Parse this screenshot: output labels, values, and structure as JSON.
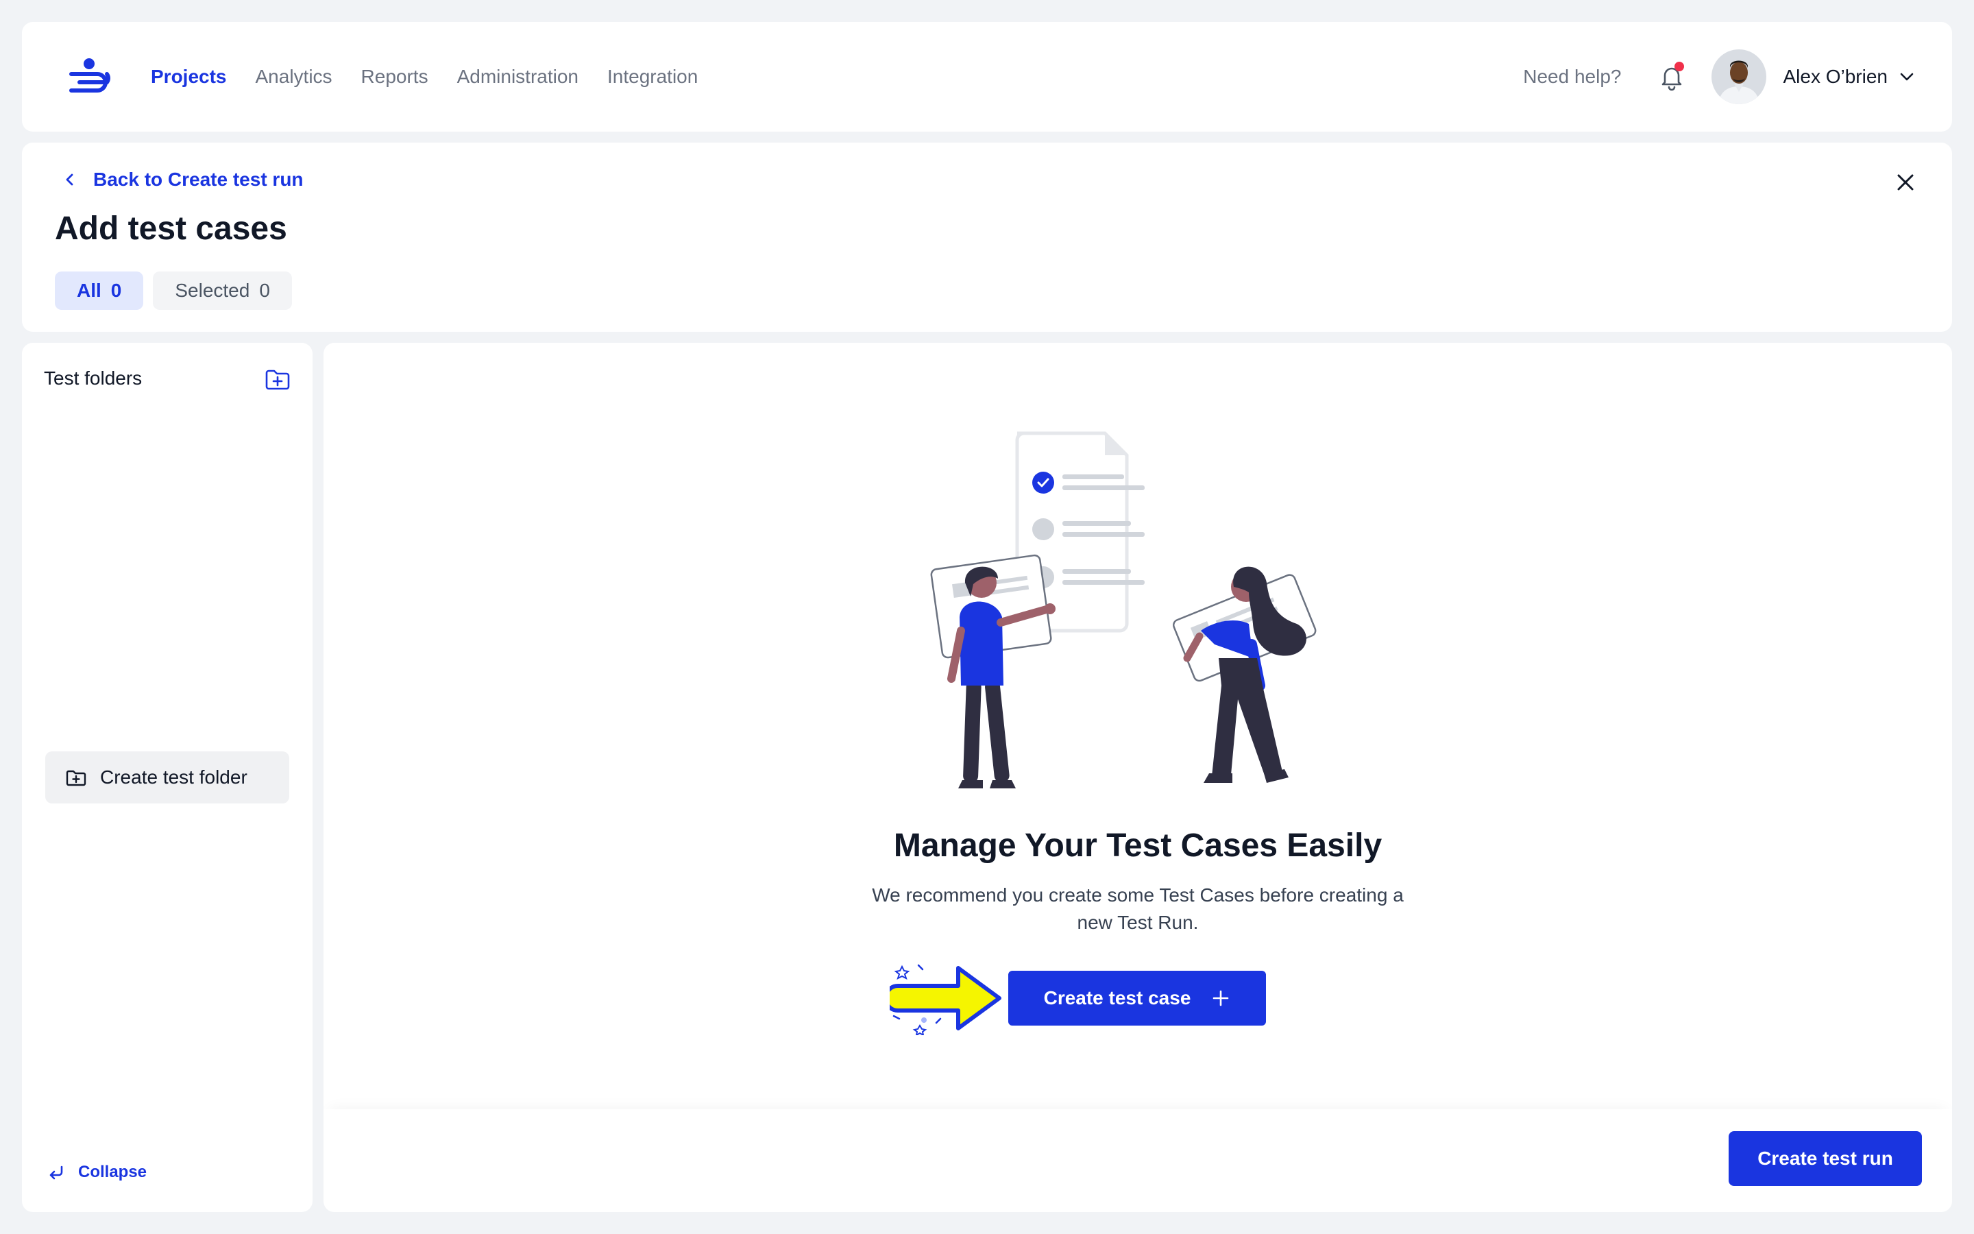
{
  "nav": {
    "items": [
      {
        "label": "Projects",
        "active": true
      },
      {
        "label": "Analytics",
        "active": false
      },
      {
        "label": "Reports",
        "active": false
      },
      {
        "label": "Administration",
        "active": false
      },
      {
        "label": "Integration",
        "active": false
      }
    ],
    "help_label": "Need help?",
    "user_name": "Alex O’brien",
    "icons": [
      "logo-icon",
      "bell-icon",
      "chevron-down-icon"
    ]
  },
  "header": {
    "back_label": "Back to Create test run",
    "title": "Add test cases",
    "tabs": [
      {
        "label": "All",
        "count": "0",
        "active": true
      },
      {
        "label": "Selected",
        "count": "0",
        "active": false
      }
    ]
  },
  "sidebar": {
    "title": "Test folders",
    "create_folder_label": "Create test folder",
    "collapse_label": "Collapse"
  },
  "empty_state": {
    "title": "Manage Your Test Cases Easily",
    "description": "We recommend you create some Test Cases before creating a new Test Run.",
    "create_case_label": "Create test case"
  },
  "footer": {
    "create_run_label": "Create test run"
  },
  "colors": {
    "primary": "#1a35e0",
    "background": "#f1f3f6",
    "highlight_arrow": "#f5f500",
    "notification_dot": "#f0304a"
  }
}
